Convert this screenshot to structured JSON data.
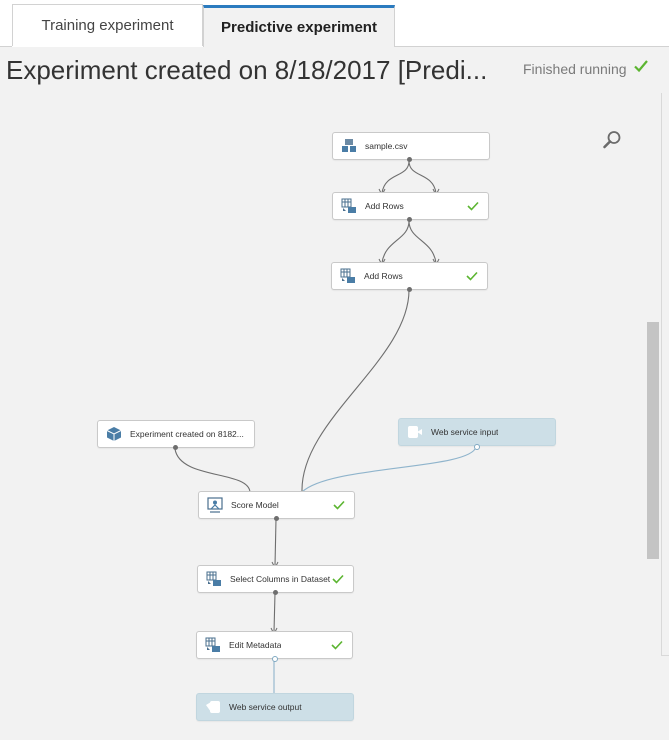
{
  "tabs": [
    {
      "label": "Training experiment",
      "active": false
    },
    {
      "label": "Predictive experiment",
      "active": true
    }
  ],
  "header": {
    "title": "Experiment created on 8/18/2017 [Predi...",
    "status": "Finished running"
  },
  "modules": {
    "sample_csv": {
      "label": "sample.csv",
      "icon": "dataset-icon",
      "completed": false
    },
    "add_rows_1": {
      "label": "Add Rows",
      "icon": "table-transform-icon",
      "completed": true
    },
    "add_rows_2": {
      "label": "Add Rows",
      "icon": "table-transform-icon",
      "completed": true
    },
    "trained_model": {
      "label": "Experiment created on 8182...",
      "icon": "trained-model-icon",
      "completed": false
    },
    "web_service_input": {
      "label": "Web service input",
      "icon": "web-service-input-icon",
      "completed": false
    },
    "score_model": {
      "label": "Score Model",
      "icon": "score-model-icon",
      "completed": true
    },
    "select_columns": {
      "label": "Select Columns in Dataset",
      "icon": "table-transform-icon",
      "completed": true
    },
    "edit_metadata": {
      "label": "Edit Metadata",
      "icon": "table-transform-icon",
      "completed": true
    },
    "web_service_output": {
      "label": "Web service output",
      "icon": "web-service-output-icon",
      "completed": false
    }
  },
  "colors": {
    "accent_blue": "#2b7bbf",
    "success_green": "#5cb531",
    "web_service_fill": "#cddfe7",
    "canvas_background": "#f2f2f2",
    "connector_gray": "#6e6e6e",
    "connector_blue": "#8fb4cc"
  }
}
